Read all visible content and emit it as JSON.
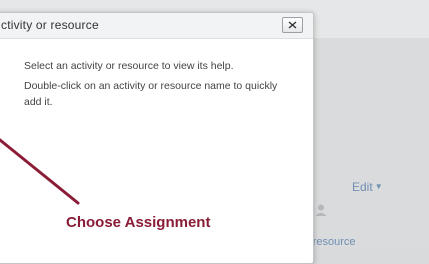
{
  "dialog": {
    "title": "ctivity or resource",
    "close_label": "X",
    "help_text": "Select an activity or resource to view its help.",
    "instruction_text": "Double-click on an activity or resource name to quickly add it."
  },
  "background": {
    "edit_label": "Edit",
    "resource_link": "r resource"
  },
  "annotation": {
    "label": "Choose Assignment",
    "color": "#8a1c36"
  },
  "colors": {
    "link": "#6f8fb4",
    "dialog_header": "#f2f3f4",
    "page_background": "#dadbdc"
  }
}
